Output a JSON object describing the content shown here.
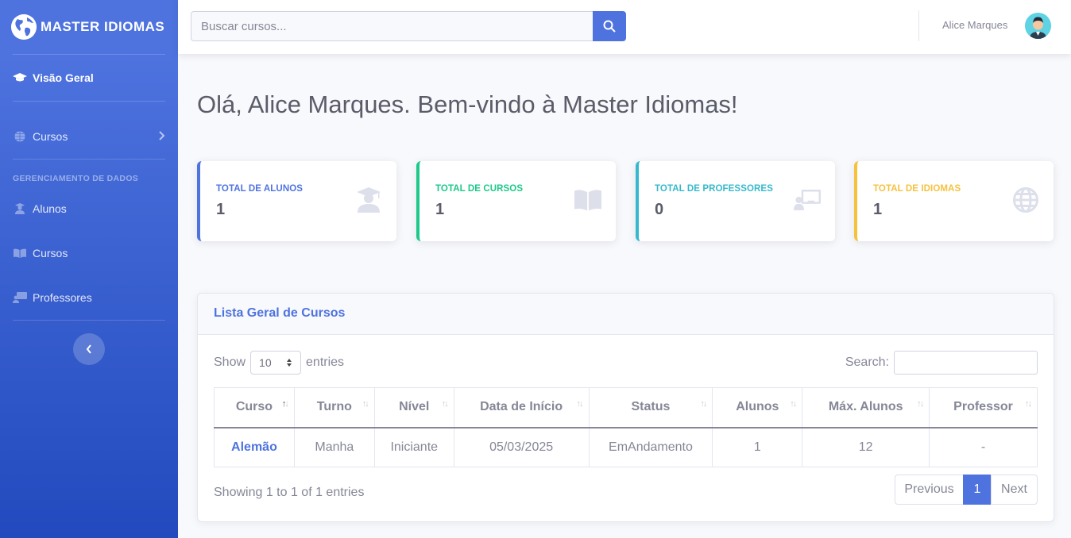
{
  "brand": {
    "name": "MASTER IDIOMAS"
  },
  "sidebar": {
    "items": [
      {
        "label": "Visão Geral",
        "icon": "graduation-cap-icon"
      },
      {
        "label": "Cursos",
        "icon": "globe-icon"
      }
    ],
    "heading": "GERENCIAMENTO DE DADOS",
    "data_items": [
      {
        "label": "Alunos",
        "icon": "student-icon"
      },
      {
        "label": "Cursos",
        "icon": "book-icon"
      },
      {
        "label": "Professores",
        "icon": "teacher-icon"
      }
    ]
  },
  "topbar": {
    "search_placeholder": "Buscar cursos...",
    "user_name": "Alice Marques"
  },
  "main": {
    "greeting": "Olá, Alice Marques. Bem-vindo à Master Idiomas!",
    "cards": [
      {
        "title": "TOTAL DE ALUNOS",
        "value": "1",
        "icon": "student-icon",
        "color": "#4e73df"
      },
      {
        "title": "TOTAL DE CURSOS",
        "value": "1",
        "icon": "book-icon",
        "color": "#1cc88a"
      },
      {
        "title": "TOTAL DE PROFESSORES",
        "value": "0",
        "icon": "teacher-icon",
        "color": "#36b9cc"
      },
      {
        "title": "TOTAL DE IDIOMAS",
        "value": "1",
        "icon": "globe-icon",
        "color": "#f6c23e"
      }
    ]
  },
  "courses_table": {
    "title": "Lista Geral de Cursos",
    "show_label": "Show",
    "entries_label": "entries",
    "page_length": "10",
    "search_label": "Search:",
    "columns": [
      "Curso",
      "Turno",
      "Nível",
      "Data de Início",
      "Status",
      "Alunos",
      "Máx. Alunos",
      "Professor"
    ],
    "rows": [
      [
        "Alemão",
        "Manha",
        "Iniciante",
        "05/03/2025",
        "EmAndamento",
        "1",
        "12",
        "-"
      ]
    ],
    "info": "Showing 1 to 1 of 1 entries",
    "pagination": {
      "previous": "Previous",
      "current": "1",
      "next": "Next"
    }
  },
  "colors": {
    "primary": "#4e73df",
    "success": "#1cc88a",
    "info": "#36b9cc",
    "warning": "#f6c23e"
  }
}
